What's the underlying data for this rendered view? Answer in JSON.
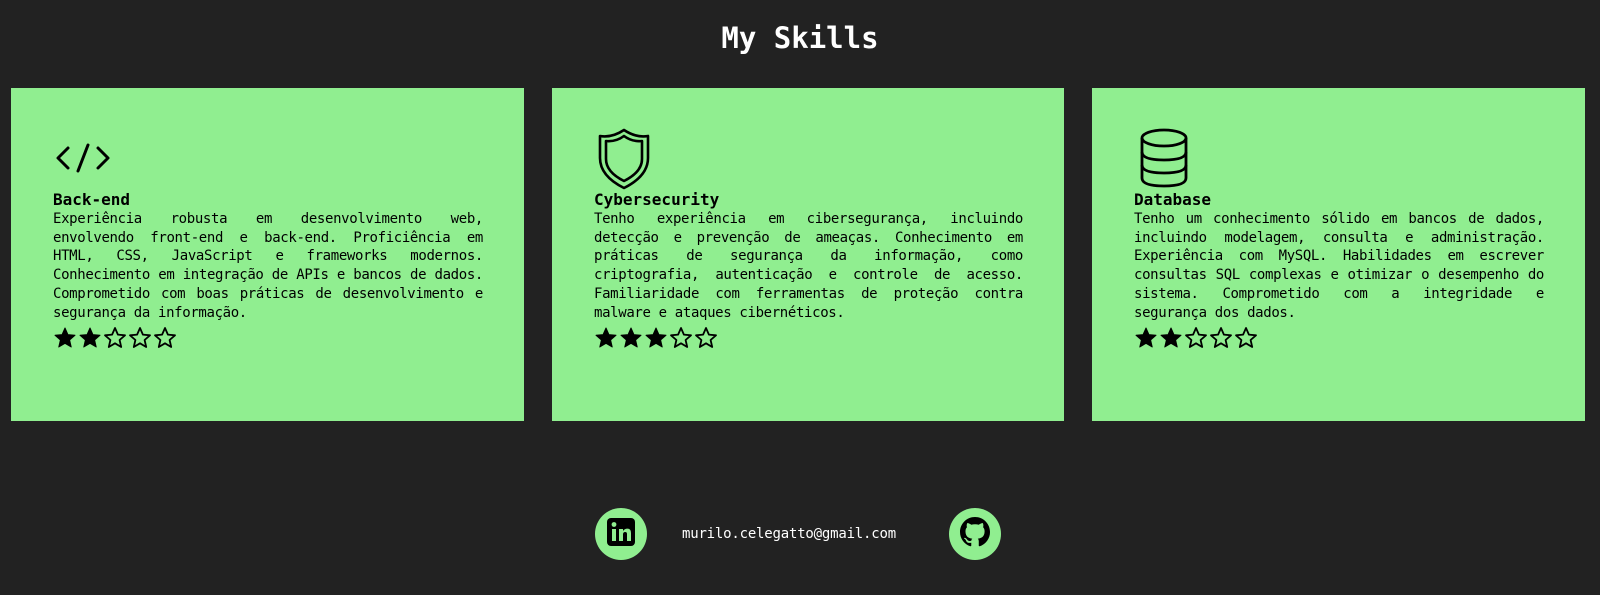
{
  "page": {
    "title": "My Skills"
  },
  "colors": {
    "background": "#222222",
    "card": "#90ee90",
    "text": "#000000",
    "heading": "#ffffff"
  },
  "skills": [
    {
      "icon": "code-icon",
      "title": "Back-end",
      "description": "Experiência robusta em desenvolvimento web, envolvendo front-end e back-end. Proficiência em HTML, CSS, JavaScript e frameworks modernos. Conhecimento em integração de APIs e bancos de dados. Comprometido com boas práticas de desenvolvimento e segurança da informação.",
      "rating": 2,
      "rating_max": 5
    },
    {
      "icon": "shield-icon",
      "title": "Cybersecurity",
      "description": "Tenho experiência em cibersegurança, incluindo detecção e prevenção de ameaças. Conhecimento em práticas de segurança da informação, como criptografia, autenticação e controle de acesso. Familiaridade com ferramentas de proteção contra malware e ataques cibernéticos.",
      "rating": 3,
      "rating_max": 5
    },
    {
      "icon": "database-icon",
      "title": "Database",
      "description": "Tenho um conhecimento sólido em bancos de dados, incluindo modelagem, consulta e administração. Experiência com MySQL. Habilidades em escrever consultas SQL complexas e otimizar o desempenho do sistema. Comprometido com a integridade e segurança dos dados.",
      "rating": 2,
      "rating_max": 5
    }
  ],
  "footer": {
    "email": "murilo.celegatto@gmail.com",
    "linkedin_icon": "linkedin-icon",
    "github_icon": "github-icon"
  }
}
